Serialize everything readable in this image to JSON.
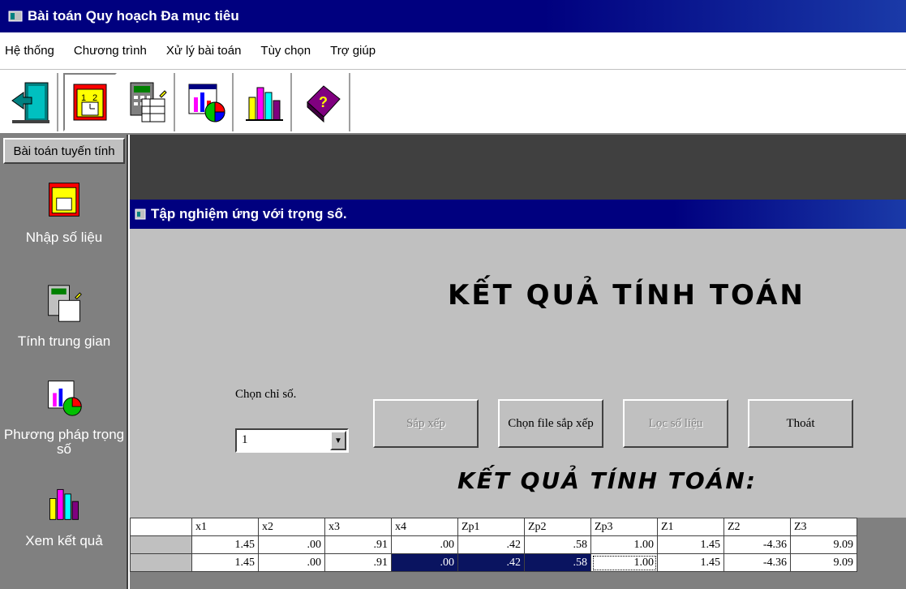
{
  "window": {
    "title": "Bài toán Quy hoạch Đa mục tiêu"
  },
  "menu": [
    {
      "label": "Hệ thống"
    },
    {
      "label": "Chương trình"
    },
    {
      "label": "Xử lý bài toán"
    },
    {
      "label": "Tùy chọn"
    },
    {
      "label": "Trợ giúp"
    }
  ],
  "toolbar": {
    "buttons": [
      {
        "icon": "exit-door-icon"
      },
      {
        "icon": "calendar-input-icon"
      },
      {
        "icon": "calculator-icon"
      },
      {
        "icon": "chart-pie-icon"
      },
      {
        "icon": "bar-chart-icon"
      },
      {
        "icon": "help-book-icon"
      }
    ]
  },
  "sidebar": {
    "header": "Bài toán tuyến tính",
    "items": [
      {
        "label": "Nhập số liệu",
        "icon": "calendar-input-icon"
      },
      {
        "label": "Tính trung gian",
        "icon": "calculator-icon"
      },
      {
        "label": "Phương pháp trọng số",
        "icon": "chart-pie-icon"
      },
      {
        "label": "Xem kết quả",
        "icon": "bar-chart-icon"
      }
    ]
  },
  "child": {
    "title": "Tập nghiệm ứng với trọng số.",
    "heading": "KẾT QUẢ TÍNH TOÁN",
    "chon_label": "Chọn chỉ số.",
    "combo_value": "1",
    "buttons": {
      "sort": "Sắp xếp",
      "choose_file": "Chọn file sắp xếp",
      "filter": "Lọc số liệu",
      "exit": "Thoát"
    },
    "subheading": "KẾT QUẢ TÍNH TOÁN:"
  },
  "table": {
    "columns": [
      "x1",
      "x2",
      "x3",
      "x4",
      "Zp1",
      "Zp2",
      "Zp3",
      "Z1",
      "Z2",
      "Z3"
    ],
    "rows": [
      [
        "1.45",
        ".00",
        ".91",
        ".00",
        ".42",
        ".58",
        "1.00",
        "1.45",
        "-4.36",
        "9.09"
      ],
      [
        "1.45",
        ".00",
        ".91",
        ".00",
        ".42",
        ".58",
        "1.00",
        "1.45",
        "-4.36",
        "9.09"
      ]
    ]
  },
  "colors": {
    "titlebar": "#00007f",
    "face": "#c0c0c0",
    "selection": "#0a1460"
  }
}
